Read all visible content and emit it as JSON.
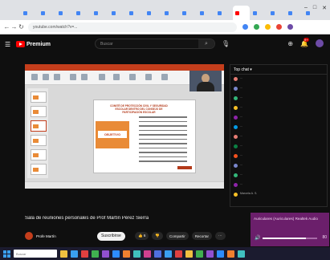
{
  "browser": {
    "tab_count": 17,
    "url": "youtube.com/watch?v=...",
    "window_controls": [
      "–",
      "□",
      "✕"
    ]
  },
  "youtube": {
    "logo_text": "Premium",
    "search_placeholder": "Buscar",
    "notification_count": "9+"
  },
  "video": {
    "slide_title": "COMITÉ DE PROTECCIÓN CIVIL Y SEGURIDAD ESCOLAR DENTRO DEL CONSEJO DE PARTICIPACIÓN ESCOLAR",
    "slide_tag": "OBJETIVO"
  },
  "below": {
    "title": "Sala de reuniones personales de Prof Martín Pérez Sierra",
    "channel_name": "Profe Martín",
    "channel_subs": "",
    "subscribe_label": "Suscribirse",
    "actions": [
      "👍 6",
      "👎",
      "Compartir",
      "Recortar",
      "⋯"
    ]
  },
  "chat": {
    "header": "Top chat ▾",
    "messages": [
      {
        "color": "#e67c73",
        "text": "..."
      },
      {
        "color": "#7986cb",
        "text": "..."
      },
      {
        "color": "#33b679",
        "text": "..."
      },
      {
        "color": "#f6bf26",
        "text": "..."
      },
      {
        "color": "#8e24aa",
        "text": "..."
      },
      {
        "color": "#039be5",
        "text": "..."
      },
      {
        "color": "#e67c73",
        "text": "..."
      },
      {
        "color": "#0b8043",
        "text": "..."
      },
      {
        "color": "#f4511e",
        "text": "..."
      },
      {
        "color": "#7986cb",
        "text": "..."
      },
      {
        "color": "#33b679",
        "text": "..."
      },
      {
        "color": "#8e24aa",
        "text": "..."
      },
      {
        "color": "#f6bf26",
        "text": "Marcela A. S."
      }
    ]
  },
  "media_toast": {
    "title": "Auriculares (Auriculares) Realtek Audio",
    "volume": "80",
    "volume_fraction": 0.8
  },
  "taskbar": {
    "search_placeholder": "Buscar",
    "time": "",
    "date": "",
    "icon_colors": [
      "#f0c040",
      "#3a9ff0",
      "#e04040",
      "#40b050",
      "#9050d0",
      "#2d8cff",
      "#f08030",
      "#40c0c0",
      "#d04090",
      "#5070e0",
      "#3a9ff0",
      "#e04040",
      "#f0c040",
      "#40b050",
      "#9050d0",
      "#2d8cff",
      "#f08030",
      "#40c0c0"
    ]
  }
}
